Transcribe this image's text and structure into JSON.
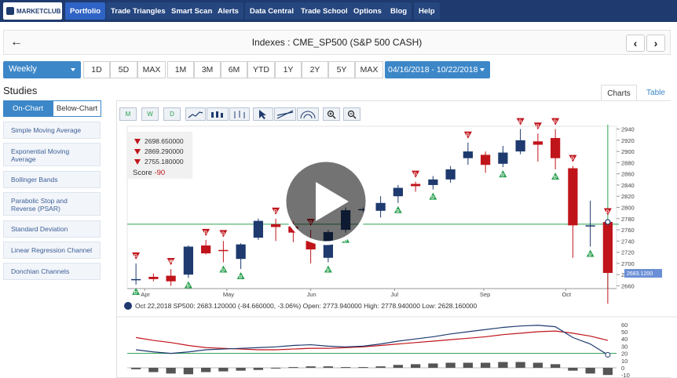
{
  "nav": {
    "logo_text": "MARKETCLUB",
    "items": [
      "Portfolio",
      "Trade Triangles",
      "Smart Scan",
      "Alerts",
      "Data Central",
      "Trade School",
      "Options",
      "Blog",
      "Help"
    ]
  },
  "title": "Indexes : CME_SP500 (S&P 500 CASH)",
  "back_icon": "←",
  "prev_icon": "‹",
  "next_icon": "›",
  "period": "Weekly",
  "ranges": [
    "1D",
    "5D",
    "MAX",
    "1M",
    "3M",
    "6M",
    "YTD",
    "1Y",
    "2Y",
    "5Y",
    "MAX"
  ],
  "date_range": "04/16/2018 - 10/22/2018",
  "studies": {
    "title": "Studies",
    "tabs": [
      "On-Chart",
      "Below-Chart"
    ],
    "items": [
      "Simple Moving Average",
      "Exponential Moving Average",
      "Bollinger Bands",
      "Parabolic Stop and Reverse (PSAR)",
      "Standard Deviation",
      "Linear Regression Channel",
      "Donchian Channels"
    ]
  },
  "view_tabs": [
    "Charts",
    "Table"
  ],
  "tools": [
    "M",
    "W",
    "D"
  ],
  "score_box": {
    "lines": [
      "2698.650000",
      "2869.290000",
      "2755.180000"
    ],
    "score_label": "Score",
    "score_value": "-90"
  },
  "info_line": "Oct 22,2018 SP500: 2683.120000 (-84.660000, -3.06%) Open: 2773.940000 High: 2778.940000 Low: 2628.160000",
  "price_label": "2683.1200",
  "colors": {
    "up": "#1e3a6e",
    "down": "#c0141b",
    "green": "#2aa050",
    "nav": "#1e3a6e",
    "accent": "#3c87c8"
  },
  "chart_data": {
    "type": "candlestick",
    "x_tick_labels": [
      "Apr",
      "May",
      "Jun",
      "Jul",
      "Sep",
      "Oct"
    ],
    "y_ticks": [
      2660,
      2680,
      2700,
      2720,
      2740,
      2760,
      2780,
      2800,
      2820,
      2840,
      2860,
      2880,
      2900,
      2920,
      2940
    ],
    "ylim": [
      2655,
      2945
    ],
    "candles": [
      {
        "o": 2670,
        "h": 2700,
        "l": 2662,
        "c": 2672
      },
      {
        "o": 2676,
        "h": 2682,
        "l": 2668,
        "c": 2672
      },
      {
        "o": 2678,
        "h": 2690,
        "l": 2660,
        "c": 2668
      },
      {
        "o": 2680,
        "h": 2732,
        "l": 2674,
        "c": 2730
      },
      {
        "o": 2732,
        "h": 2742,
        "l": 2716,
        "c": 2718
      },
      {
        "o": 2724,
        "h": 2740,
        "l": 2702,
        "c": 2722
      },
      {
        "o": 2708,
        "h": 2736,
        "l": 2690,
        "c": 2734
      },
      {
        "o": 2746,
        "h": 2780,
        "l": 2742,
        "c": 2776
      },
      {
        "o": 2770,
        "h": 2780,
        "l": 2740,
        "c": 2765
      },
      {
        "o": 2766,
        "h": 2775,
        "l": 2738,
        "c": 2755
      },
      {
        "o": 2740,
        "h": 2760,
        "l": 2700,
        "c": 2725
      },
      {
        "o": 2710,
        "h": 2760,
        "l": 2702,
        "c": 2756
      },
      {
        "o": 2760,
        "h": 2800,
        "l": 2755,
        "c": 2795
      },
      {
        "o": 2796,
        "h": 2800,
        "l": 2792,
        "c": 2797
      },
      {
        "o": 2794,
        "h": 2820,
        "l": 2782,
        "c": 2808
      },
      {
        "o": 2820,
        "h": 2840,
        "l": 2808,
        "c": 2835
      },
      {
        "o": 2842,
        "h": 2846,
        "l": 2828,
        "c": 2838
      },
      {
        "o": 2840,
        "h": 2856,
        "l": 2832,
        "c": 2850
      },
      {
        "o": 2850,
        "h": 2874,
        "l": 2844,
        "c": 2868
      },
      {
        "o": 2888,
        "h": 2916,
        "l": 2876,
        "c": 2900
      },
      {
        "o": 2894,
        "h": 2900,
        "l": 2862,
        "c": 2876
      },
      {
        "o": 2878,
        "h": 2910,
        "l": 2872,
        "c": 2898
      },
      {
        "o": 2900,
        "h": 2940,
        "l": 2895,
        "c": 2920
      },
      {
        "o": 2918,
        "h": 2932,
        "l": 2882,
        "c": 2912
      },
      {
        "o": 2924,
        "h": 2940,
        "l": 2868,
        "c": 2888
      },
      {
        "o": 2870,
        "h": 2874,
        "l": 2710,
        "c": 2768
      },
      {
        "o": 2766,
        "h": 2812,
        "l": 2730,
        "c": 2768
      },
      {
        "o": 2774,
        "h": 2779,
        "l": 2628,
        "c": 2683
      }
    ],
    "signals": [
      {
        "i": 0,
        "dir": "down",
        "label": "D"
      },
      {
        "i": 0,
        "dir": "up",
        "label": "D"
      },
      {
        "i": 2,
        "dir": "down",
        "label": "W"
      },
      {
        "i": 3,
        "dir": "up",
        "label": "D"
      },
      {
        "i": 4,
        "dir": "down",
        "label": "D"
      },
      {
        "i": 5,
        "dir": "down",
        "label": "D"
      },
      {
        "i": 5,
        "dir": "up",
        "label": "D"
      },
      {
        "i": 6,
        "dir": "up",
        "label": "D"
      },
      {
        "i": 8,
        "dir": "down",
        "label": "D"
      },
      {
        "i": 10,
        "dir": "down",
        "label": "D"
      },
      {
        "i": 11,
        "dir": "up",
        "label": "D"
      },
      {
        "i": 12,
        "dir": "up",
        "label": "D"
      },
      {
        "i": 15,
        "dir": "up",
        "label": "D"
      },
      {
        "i": 16,
        "dir": "down",
        "label": "D"
      },
      {
        "i": 17,
        "dir": "up",
        "label": "D"
      },
      {
        "i": 19,
        "dir": "down",
        "label": "D"
      },
      {
        "i": 21,
        "dir": "up",
        "label": "D"
      },
      {
        "i": 22,
        "dir": "down",
        "label": "D"
      },
      {
        "i": 23,
        "dir": "down",
        "label": "D"
      },
      {
        "i": 24,
        "dir": "down",
        "label": "D"
      },
      {
        "i": 24,
        "dir": "up",
        "label": "D"
      },
      {
        "i": 25,
        "dir": "down",
        "label": "D"
      },
      {
        "i": 26,
        "dir": "up",
        "label": "D"
      },
      {
        "i": 27,
        "dir": "down",
        "label": "D"
      }
    ],
    "oscillator": {
      "y_ticks": [
        60,
        50,
        40,
        30,
        20,
        10,
        0,
        -10
      ],
      "ylim": [
        -12,
        62
      ],
      "red": [
        42,
        38,
        35,
        31,
        28,
        27,
        26,
        25,
        25,
        26,
        27,
        27,
        28,
        29,
        31,
        33,
        35,
        37,
        39,
        41,
        43,
        46,
        48,
        50,
        51,
        48,
        44,
        38
      ],
      "blue": [
        25,
        22,
        20,
        22,
        25,
        26,
        27,
        28,
        29,
        31,
        32,
        30,
        29,
        30,
        33,
        37,
        40,
        43,
        47,
        50,
        53,
        56,
        58,
        59,
        57,
        42,
        33,
        18
      ],
      "bars": [
        -2,
        -6,
        -8,
        -9,
        -6,
        -5,
        -4,
        -3,
        -1,
        1,
        2,
        2,
        1,
        1,
        2,
        4,
        5,
        6,
        7,
        7,
        7,
        8,
        8,
        7,
        5,
        -4,
        -8,
        -10
      ]
    }
  }
}
